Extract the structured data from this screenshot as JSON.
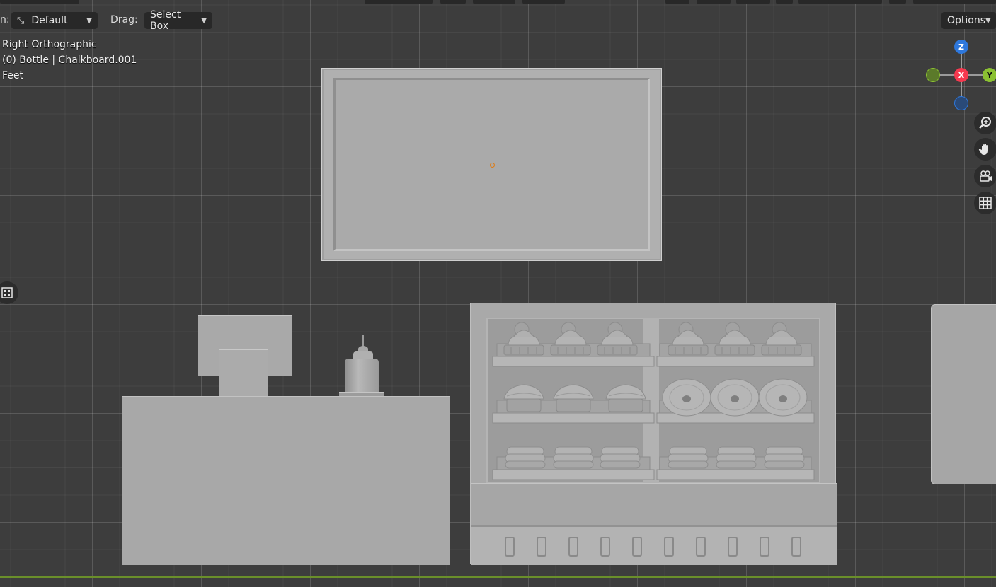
{
  "toolbar": {
    "orientation_label": "n:",
    "orientation_value": "Default",
    "drag_label": "Drag:",
    "drag_value": "Select Box",
    "options_label": "Options"
  },
  "overlay": {
    "view_name": "Right Orthographic",
    "selection_info": "(0) Bottle | Chalkboard.001",
    "units": "Feet"
  },
  "gizmo": {
    "z_label": "Z",
    "x_label": "X",
    "y_label": "Y",
    "colors": {
      "x": "#f5394f",
      "y": "#8bc132",
      "z": "#2e78dd",
      "y_neg": "#5b7a2a",
      "z_neg": "#2a4a78"
    }
  },
  "icons": {
    "zoom": "zoom-icon",
    "pan": "hand-icon",
    "camera": "camera-icon",
    "grid": "grid-icon",
    "transform_pivot": "pivot-icon"
  }
}
